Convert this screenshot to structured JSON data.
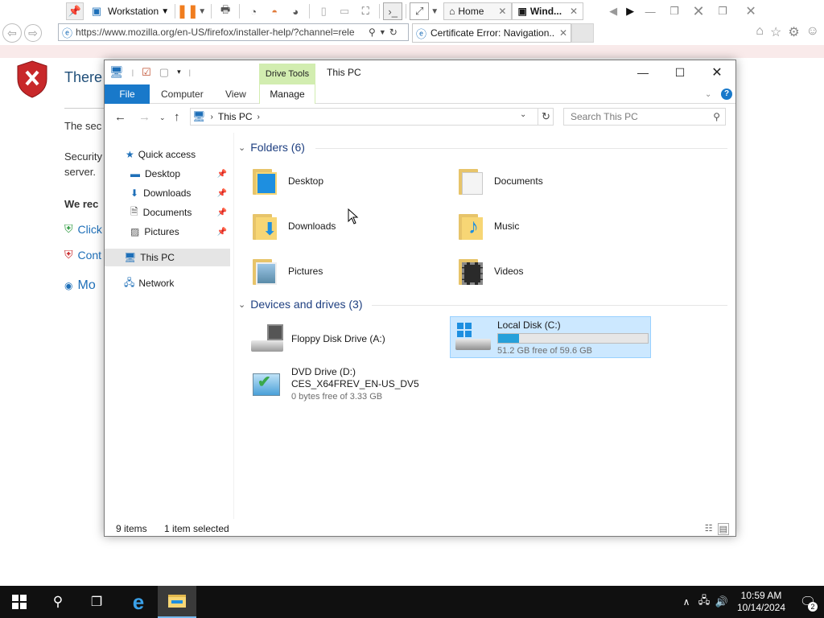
{
  "vm_toolbar": {
    "machine_name": "Workstation",
    "tab_home": "Home",
    "tab_active": "Wind..."
  },
  "browser": {
    "url": "https://www.mozilla.org/en-US/firefox/installer-help/?channel=rele",
    "tab_title": "Certificate Error: Navigation..."
  },
  "ie_page": {
    "heading": "There",
    "line1": "The sec",
    "line2a": "Security",
    "line2b": "server.",
    "recommend": "We rec",
    "link1": "Click",
    "link2": "Cont",
    "more": "Mo"
  },
  "explorer": {
    "contextual_tab": "Drive Tools",
    "title": "This PC",
    "ribbon_tabs": {
      "file": "File",
      "computer": "Computer",
      "view": "View",
      "manage": "Manage"
    },
    "breadcrumb": "This PC",
    "search_placeholder": "Search This PC",
    "nav": {
      "quick_access": "Quick access",
      "desktop": "Desktop",
      "downloads": "Downloads",
      "documents": "Documents",
      "pictures": "Pictures",
      "this_pc": "This PC",
      "network": "Network"
    },
    "folders_header": "Folders (6)",
    "folders": {
      "desktop": "Desktop",
      "documents": "Documents",
      "downloads": "Downloads",
      "music": "Music",
      "pictures": "Pictures",
      "videos": "Videos"
    },
    "devices_header": "Devices and drives (3)",
    "drives": {
      "floppy": {
        "name": "Floppy Disk Drive (A:)"
      },
      "local": {
        "name": "Local Disk (C:)",
        "free": "51.2 GB free of 59.6 GB",
        "used_fraction": 0.14
      },
      "dvd": {
        "name": "DVD Drive (D:)",
        "label": "CES_X64FREV_EN-US_DV5",
        "free": "0 bytes free of 3.33 GB"
      }
    },
    "status": {
      "items": "9 items",
      "selected": "1 item selected"
    }
  },
  "taskbar": {
    "time": "10:59 AM",
    "date": "10/14/2024",
    "notification_count": "2"
  }
}
